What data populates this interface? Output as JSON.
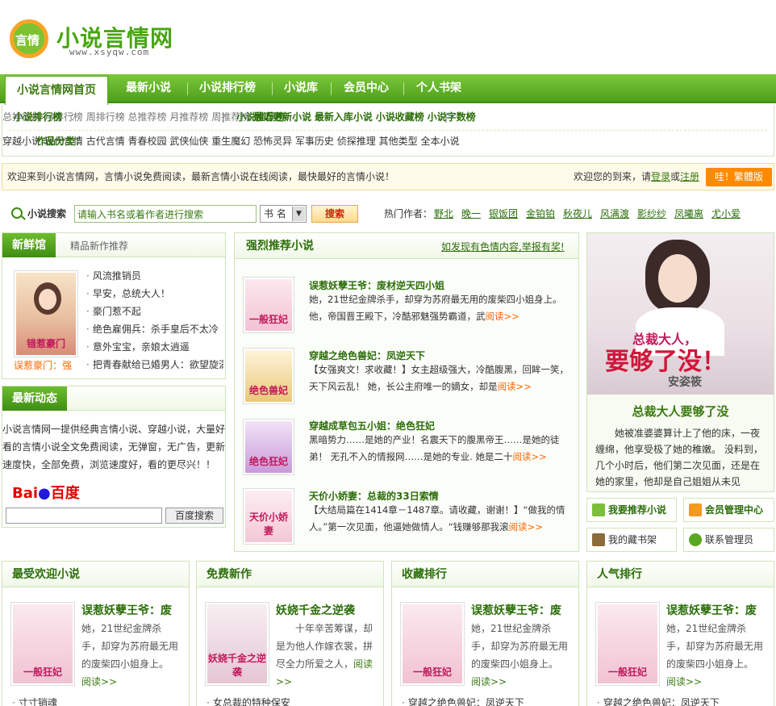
{
  "logo": {
    "text": "小说言情网",
    "url": "www.xsyqw.com",
    "badge": "言情"
  },
  "nav": [
    "小说言情网首页",
    "最新小说",
    "小说排行榜",
    "小说库",
    "会员中心",
    "个人书架"
  ],
  "rank_row": {
    "label": "小说排行榜",
    "items": [
      "总排行榜",
      "月排行榜",
      "周排行榜"
    ],
    "rec_label": "小说推荐榜",
    "rec_items": [
      "总推荐榜",
      "月推荐榜",
      "周推荐榜"
    ],
    "extra": [
      "最近更新小说",
      "最新入库小说",
      "小说收藏榜",
      "小说字数榜"
    ]
  },
  "category_row": {
    "label": "作品分类：",
    "items": [
      "穿越小说",
      "现代言情",
      "古代言情",
      "青春校园",
      "武侠仙侠",
      "重生魔幻",
      "恐怖灵异",
      "军事历史",
      "侦探推理",
      "其他类型",
      "全本小说"
    ]
  },
  "welcome": {
    "left": "欢迎来到小说言情网，言情小说免费阅读，最新言情小说在线阅读，最快最好的言情小说！",
    "right_prefix": "欢迎您的到来，请",
    "login": "登录",
    "or": "或",
    "register": "注册",
    "button": "哇！繁體版"
  },
  "search": {
    "label": "小说搜索",
    "placeholder": "请输入书名或着作者进行搜索",
    "select": "书 名",
    "button": "搜索",
    "hot_label": "热门作者：",
    "authors": [
      "野北",
      "晚一",
      "银饭团",
      "金铂铂",
      "秋夜儿",
      "风满渡",
      "影纱纱",
      "凤曦离",
      "尤小爱"
    ]
  },
  "fresh": {
    "tab": "新鲜馆",
    "sub": "精品新作推荐",
    "caption": "误惹豪门：强",
    "cover_title": "错惹豪门",
    "items": [
      "风流推销员",
      "早安，总统大人！",
      "豪门惹不起",
      "绝色雇佣兵：杀手皇后不太冷",
      "意外宝宝，亲娘太逍遥",
      "把青春献给已婚男人：欲望旋涡"
    ]
  },
  "news": {
    "tab": "最新动态",
    "text": "小说言情网一提供经典言情小说、穿越小说，大量好看的言情小说全文免费阅读，无弹窗，无广告，更新速度快，全部免费，浏览速度好，看的更尽兴！！",
    "baidu": "百度",
    "baidu_button": "百度搜索"
  },
  "recommend": {
    "title": "强烈推荐小说",
    "report": "如发现有色情内容,举报有奖!",
    "more": "阅读>>",
    "books": [
      {
        "title": "误惹妖孽王爷：废材逆天四小姐",
        "desc": "她，21世纪金牌杀手，却穿为苏府最无用的废柴四小姐身上。他，帝国晋王殿下，冷酷邪魅强势霸道，武",
        "cover": "一般狂妃"
      },
      {
        "title": "穿越之绝色兽妃：凤逆天下",
        "desc": "【女强爽文！求收藏！】女主超级强大，冷酷腹黑，回眸一笑，天下风云乱！ 她，长公主府唯一的嫡女，却是",
        "cover": "绝色兽妃"
      },
      {
        "title": "穿越成草包五小姐：绝色狂妃",
        "desc": "黑暗势力……是她的产业！名震天下的腹黑帝王……是她的徒弟！ 无孔不入的情报网……是她的专业. 她是二十",
        "cover": "绝色狂妃"
      },
      {
        "title": "天价小娇妻：总裁的33日索情",
        "desc": "【大结局篇在1414章－1487章。请收藏，谢谢！】“做我的情人。”第一次见面，他逼她做情人。“钱赚够那我滚",
        "cover": "天价小娇妻"
      }
    ]
  },
  "feature": {
    "cover_top": "总裁大人，",
    "cover_big": "要够了没！",
    "cover_author": "安姿筱",
    "title": "总裁大人要够了没",
    "desc": "她被准婆婆算计上了他的床，一夜缠绵，他享受极了她的稚嫩。 没料到，几个小时后，他们第二次见面，还是在她的家里，他却是自己姐姐从未见"
  },
  "side_buttons": [
    "我要推荐小说",
    "会员管理中心",
    "我的藏书架",
    "联系管理员"
  ],
  "columns": [
    {
      "title": "最受欢迎小说",
      "book": "误惹妖孽王爷：废",
      "desc": "她，21世纪金牌杀手，却穿为苏府最无用的废柴四小姐身上。",
      "more": "阅读>>",
      "cover": "一般狂妃",
      "item": "寸寸销魂"
    },
    {
      "title": "免费新作",
      "book": "妖娆千金之逆袭",
      "desc": "十年辛苦筹谋，却是为他人作嫁衣裳，拼尽全力所爱之人，",
      "more": "阅读>>",
      "cover": "妖娆千金之逆袭",
      "item": "女总裁的特种保安"
    },
    {
      "title": "收藏排行",
      "book": "误惹妖孽王爷：废",
      "desc": "她，21世纪金牌杀手，却穿为苏府最无用的废柴四小姐身上。",
      "more": "阅读>>",
      "cover": "一般狂妃",
      "item": "穿越之绝色兽妃：凤逆天下"
    },
    {
      "title": "人气排行",
      "book": "误惹妖孽王爷：废",
      "desc": "她，21世纪金牌杀手，却穿为苏府最无用的废柴四小姐身上。",
      "more": "阅读>>",
      "cover": "一般狂妃",
      "item": "穿越之绝色兽妃：凤逆天下"
    }
  ]
}
